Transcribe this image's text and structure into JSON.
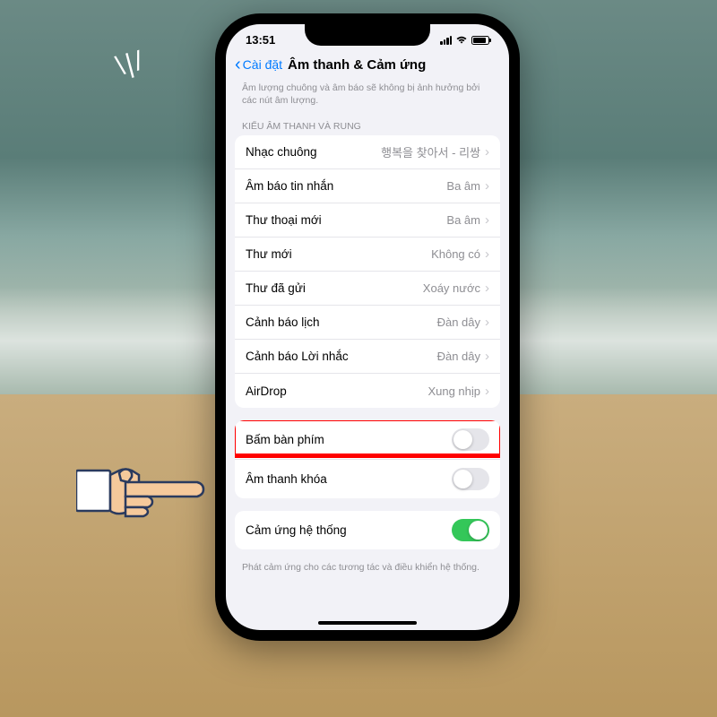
{
  "status": {
    "time": "13:51"
  },
  "nav": {
    "back": "Cài đặt",
    "title": "Âm thanh & Cảm ứng"
  },
  "note": "Âm lượng chuông và âm báo sẽ không bị ảnh hưởng bởi các nút âm lượng.",
  "section1_header": "KIỂU ÂM THANH VÀ RUNG",
  "sounds": [
    {
      "label": "Nhạc chuông",
      "value": "행복을 찾아서 - 리쌍"
    },
    {
      "label": "Âm báo tin nhắn",
      "value": "Ba âm"
    },
    {
      "label": "Thư thoại mới",
      "value": "Ba âm"
    },
    {
      "label": "Thư mới",
      "value": "Không có"
    },
    {
      "label": "Thư đã gửi",
      "value": "Xoáy nước"
    },
    {
      "label": "Cảnh báo lịch",
      "value": "Đàn dây"
    },
    {
      "label": "Cảnh báo Lời nhắc",
      "value": "Đàn dây"
    },
    {
      "label": "AirDrop",
      "value": "Xung nhịp"
    }
  ],
  "toggles": {
    "keyboard_clicks": "Bấm bàn phím",
    "lock_sound": "Âm thanh khóa"
  },
  "haptics": {
    "label": "Cảm ứng hệ thống",
    "desc": "Phát cảm ứng cho các tương tác và điều khiển hệ thống."
  }
}
